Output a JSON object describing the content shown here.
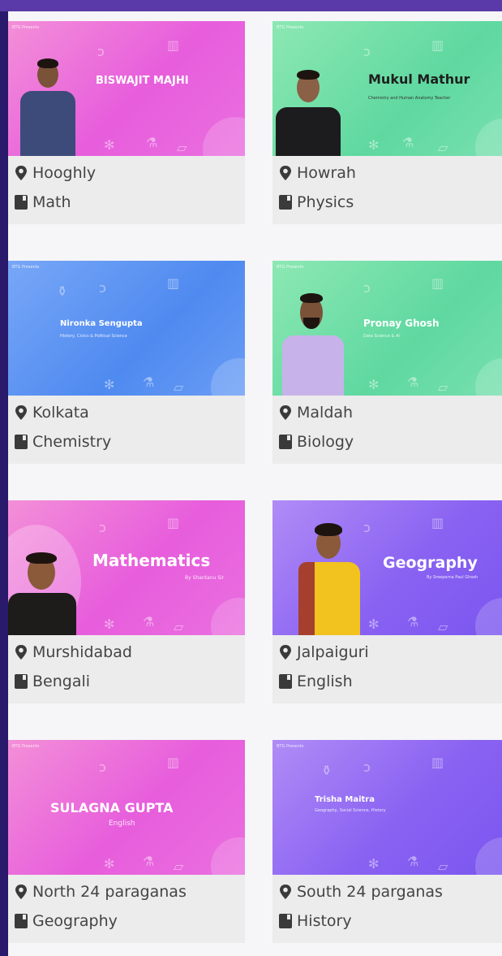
{
  "cards": [
    {
      "banner": {
        "title": "BISWAJIT MAJHI",
        "subtitle": "",
        "presents": "BTG Presents"
      },
      "location": "Hooghly",
      "subject": "Math"
    },
    {
      "banner": {
        "title": "Mukul Mathur",
        "subtitle": "Chemistry and Human Anatomy Teacher",
        "presents": "BTG Presents"
      },
      "location": "Howrah",
      "subject": "Physics"
    },
    {
      "banner": {
        "title": "Nironka Sengupta",
        "subtitle": "History, Civics & Political Science",
        "presents": "BTG Presents"
      },
      "location": "Kolkata",
      "subject": "Chemistry"
    },
    {
      "banner": {
        "title": "Pronay Ghosh",
        "subtitle": "Data Science & AI",
        "presents": "BTG Presents"
      },
      "location": "Maldah",
      "subject": "Biology"
    },
    {
      "banner": {
        "title": "Mathematics",
        "subtitle": "By Shantanu Sir",
        "presents": ""
      },
      "location": "Murshidabad",
      "subject": "Bengali"
    },
    {
      "banner": {
        "title": "Geography",
        "subtitle": "By Sreeparna Paul Ghosh",
        "presents": ""
      },
      "location": "Jalpaiguri",
      "subject": "English"
    },
    {
      "banner": {
        "title": "SULAGNA GUPTA",
        "subtitle": "English",
        "presents": "BTG Presents"
      },
      "location": "North 24 paraganas",
      "subject": "Geography"
    },
    {
      "banner": {
        "title": "Trisha Maitra",
        "subtitle": "Geography, Social Science, History",
        "presents": "BTG Presents"
      },
      "location": "South 24 parganas",
      "subject": "History"
    }
  ],
  "icons": {
    "location": "map-marker-icon",
    "subject": "book-icon"
  },
  "colors": {
    "frame": "#2a1a6b",
    "topbar": "#5a3aa8",
    "card_bg": "#ececec",
    "text": "#444444",
    "pink": "#e75ddc",
    "green": "#5fd8a0",
    "blue": "#4f8af0",
    "violet": "#8a62f2"
  }
}
